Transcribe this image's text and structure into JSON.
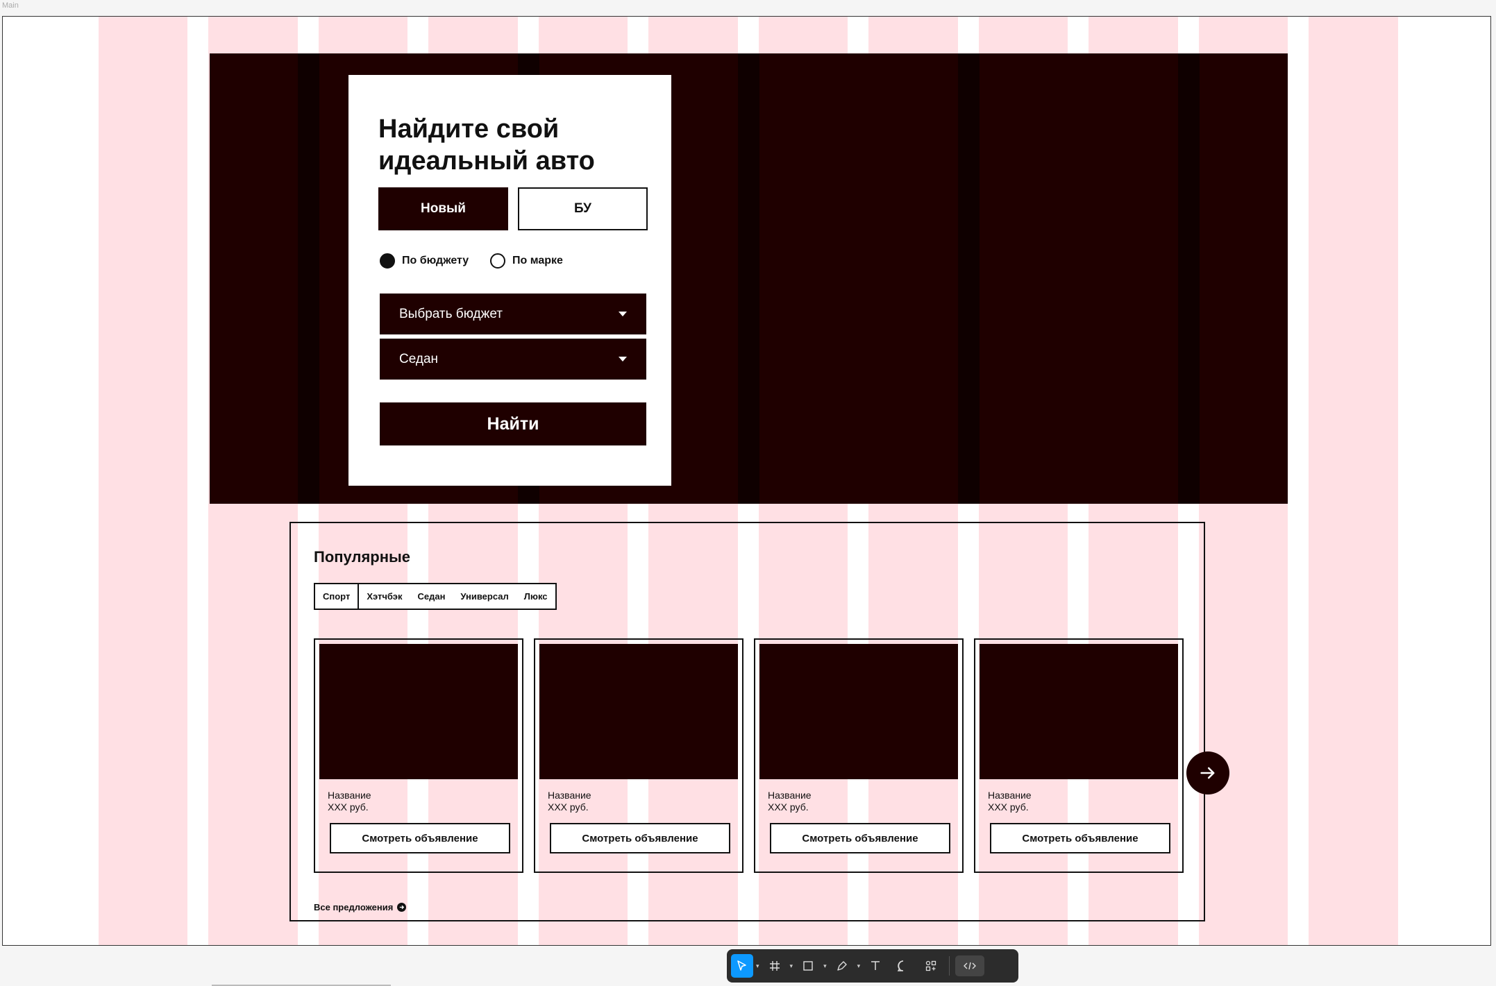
{
  "frame": {
    "label": "Main"
  },
  "hero": {
    "title_line1": "Найдите свой",
    "title_line2": "идеальный авто",
    "segment": {
      "new_label": "Новый",
      "used_label": "БУ"
    },
    "radios": [
      {
        "label": "По бюджету",
        "checked": true
      },
      {
        "label": "По марке",
        "checked": false
      }
    ],
    "budget_select": "Выбрать бюджет",
    "body_select": "Седан",
    "find_label": "Найти"
  },
  "popular": {
    "title": "Популярные",
    "tabs": [
      "Спорт",
      "Хэтчбэк",
      "Седан",
      "Универсал",
      "Люкс"
    ],
    "cards": [
      {
        "name": "Название",
        "price": "XXX руб.",
        "button": "Смотреть объявление"
      },
      {
        "name": "Название",
        "price": "XXX руб.",
        "button": "Смотреть объявление"
      },
      {
        "name": "Название",
        "price": "XXX руб.",
        "button": "Смотреть объявление"
      },
      {
        "name": "Название",
        "price": "XXX руб.",
        "button": "Смотреть объявление"
      }
    ],
    "all_offers_label": "Все предложения"
  },
  "toolbar": {
    "tools": [
      "move-tool",
      "frame-tool",
      "shape-tool",
      "pen-tool",
      "text-tool",
      "comment-tool",
      "components-tool",
      "dev-mode-toggle"
    ]
  },
  "colors": {
    "hero_bg": "#1f0000",
    "grid_overlay": "#ffe0e3",
    "accent": "#0d99ff"
  }
}
